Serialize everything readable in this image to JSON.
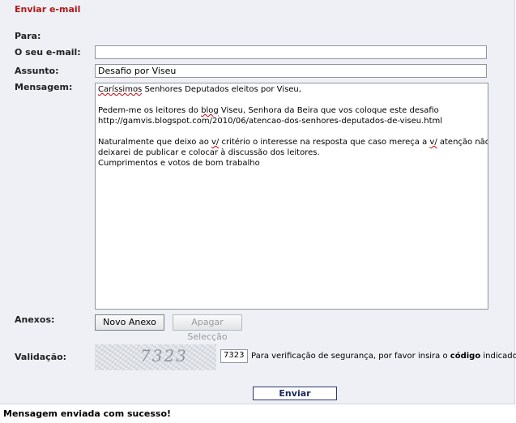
{
  "form": {
    "title": "Enviar e-mail",
    "to_label": "Para:",
    "email_label": "O seu e-mail:",
    "email_value": "",
    "subject_label": "Assunto:",
    "subject_value": "Desafio por Viseu",
    "message_label": "Mensagem:",
    "message": {
      "line1_misspelled": "Caríssimos",
      "line1_rest": " Senhores Deputados eleitos por Viseu,",
      "line2_pre": "Pedem-me os leitores do ",
      "line2_word": "blog",
      "line2_post": " Viseu, Senhora da Beira que vos coloque este desafio",
      "line3": "http://gamvis.blogspot.com/2010/06/atencao-dos-senhores-deputados-de-viseu.html",
      "line4_pre": "Naturalmente que deixo ao ",
      "line4_word1": "v/",
      "line4_mid": " critério o interesse na resposta que caso mereça a ",
      "line4_word2": "v/",
      "line4_post": " atenção não",
      "line5": "deixarei de publicar e colocar à discussão dos leitores.",
      "line6": "Cumprimentos e votos de bom trabalho"
    },
    "attachments_label": "Anexos:",
    "new_attachment_button": "Novo Anexo",
    "delete_selection_button": "Apagar Selecção",
    "validation_label": "Validação:",
    "captcha_text": "7323",
    "captcha_input_value": "7323",
    "captcha_hint_pre": "Para verificação de segurança, por favor insira o ",
    "captcha_hint_bold": "código",
    "captcha_hint_post": " indicado.",
    "send_button": "Enviar"
  },
  "status_message": "Mensagem enviada com sucesso!",
  "colors": {
    "title": "#b01818",
    "panel_background": "#eef0f6",
    "send_border": "#2b3a6e"
  }
}
